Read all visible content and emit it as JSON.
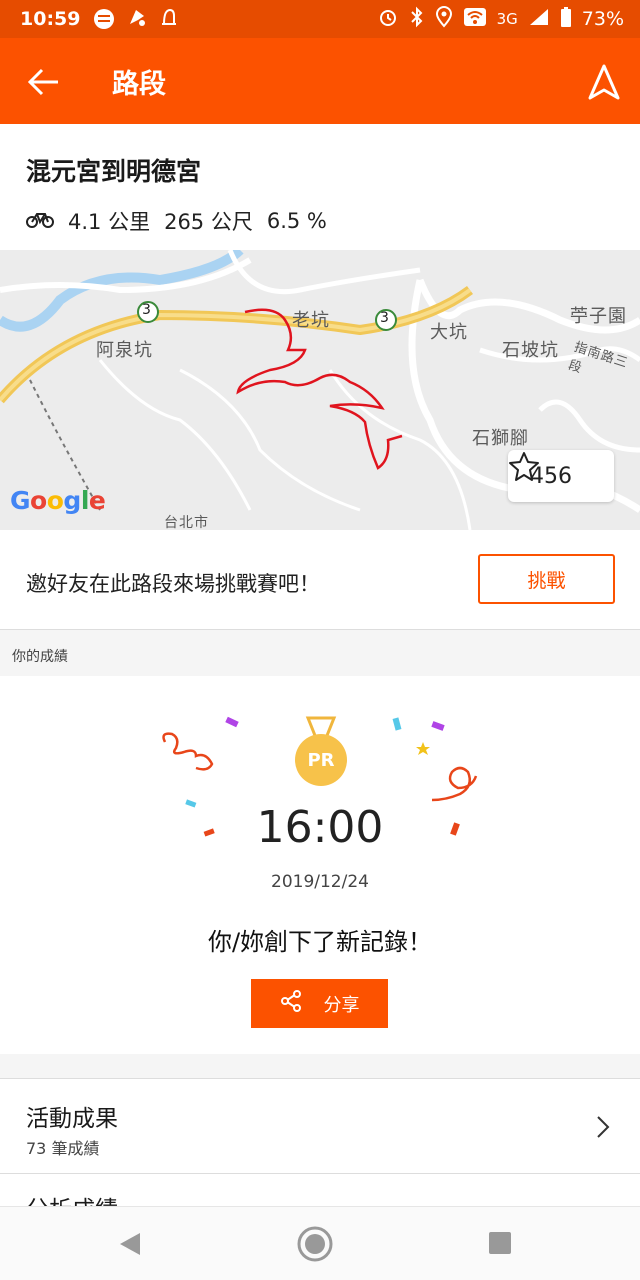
{
  "status_bar": {
    "time": "10:59",
    "network": "3G",
    "battery": "73%",
    "icons": [
      "spotify-icon",
      "notification-icon",
      "bag-icon",
      "alarm-icon",
      "bluetooth-icon",
      "location-icon",
      "wifi-icon",
      "signal-icon",
      "battery-icon"
    ]
  },
  "app_bar": {
    "title": "路段",
    "back_icon": "arrow-left-icon",
    "nav_icon": "navigation-arrow-icon"
  },
  "segment": {
    "name": "混元宮到明德宮",
    "distance": "4.1 公里",
    "elevation": "265 公尺",
    "grade": "6.5 %"
  },
  "map": {
    "labels": [
      "老坑",
      "大坑",
      "阿泉坑",
      "石坡坑",
      "石獅腳",
      "苧子園",
      "指南路三段",
      "台北市"
    ],
    "highway_shield": "3",
    "attribution": "Google",
    "star_count": "456"
  },
  "challenge": {
    "prompt": "邀好友在此路段來場挑戰賽吧！",
    "button": "挑戰"
  },
  "results": {
    "section_label": "你的成績",
    "badge": "PR",
    "time": "16:00",
    "date": "2019/12/24",
    "message": "你/妳創下了新記錄！",
    "share_button": "分享"
  },
  "rows": {
    "activities_title": "活動成果",
    "activities_count": "73 筆成績",
    "analysis_title": "分析成績"
  },
  "colors": {
    "brand_orange": "#fc5200",
    "status_orange": "#e64c00",
    "route_red": "#e0141e",
    "medal_gold": "#f7c24a"
  }
}
